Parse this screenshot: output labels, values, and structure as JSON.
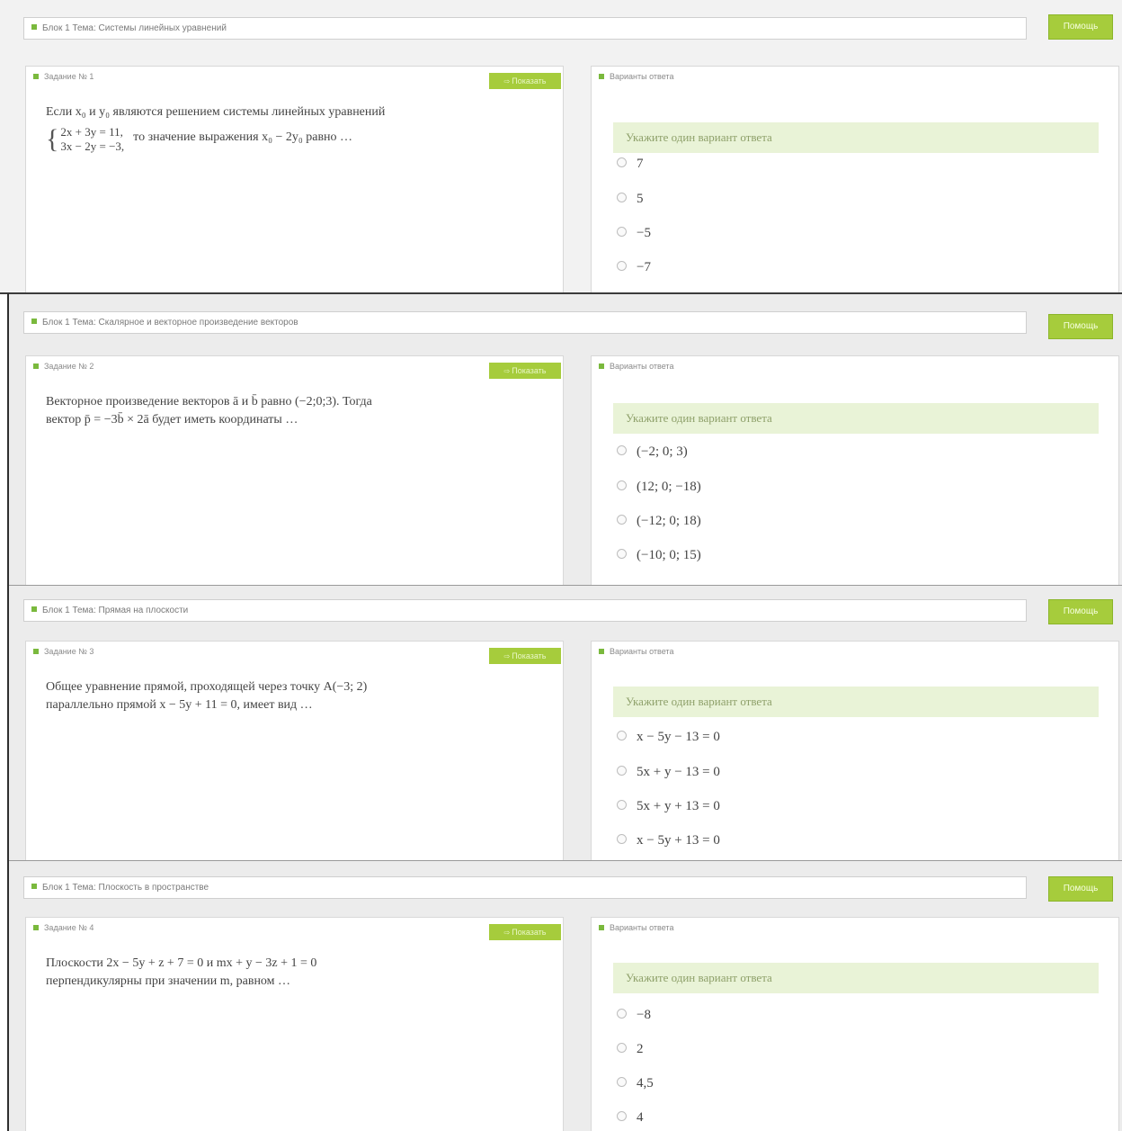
{
  "help_label": "Помощь",
  "show_label": "Показать",
  "panels": [
    {
      "topic": "Блок 1 Тема: Системы линейных уравнений",
      "task_title": "Задание № 1",
      "answers_title": "Варианты ответа",
      "instruction": "Укажите один вариант ответа",
      "question_a": "Если x₀ и y₀ являются решением системы линейных уравнений",
      "system_eq1": "2x + 3y = 11,",
      "system_eq2": "3x − 2y = −3,",
      "question_b": "то значение выражения x₀ − 2y₀ равно …",
      "options": [
        "7",
        "5",
        "−5",
        "−7"
      ]
    },
    {
      "topic": "Блок 1 Тема: Скалярное и векторное произведение векторов",
      "task_title": "Задание № 2",
      "answers_title": "Варианты ответа",
      "instruction": "Укажите один вариант ответа",
      "question_a": "Векторное произведение векторов ā и b̄ равно (−2;0;3). Тогда",
      "question_b": "вектор p̄ = −3b̄ × 2ā будет иметь координаты …",
      "options": [
        "(−2; 0; 3)",
        "(12; 0; −18)",
        "(−12; 0; 18)",
        "(−10; 0; 15)"
      ]
    },
    {
      "topic": "Блок 1 Тема: Прямая на плоскости",
      "task_title": "Задание № 3",
      "answers_title": "Варианты ответа",
      "instruction": "Укажите один вариант ответа",
      "question_a": "Общее уравнение прямой, проходящей через точку A(−3; 2)",
      "question_b": "параллельно прямой x − 5y + 11 = 0, имеет вид …",
      "options": [
        "x − 5y − 13 = 0",
        "5x + y − 13 = 0",
        "5x + y + 13 = 0",
        "x − 5y + 13 = 0"
      ]
    },
    {
      "topic": "Блок 1 Тема: Плоскость в пространстве",
      "task_title": "Задание № 4",
      "answers_title": "Варианты ответа",
      "instruction": "Укажите один вариант ответа",
      "question_a": "Плоскости 2x − 5y + z + 7 = 0 и mx + y − 3z + 1 = 0",
      "question_b": "перпендикулярны при значении m, равном …",
      "options": [
        "−8",
        "2",
        "4,5",
        "4"
      ]
    }
  ],
  "colors": {
    "accent": "#a6cc3c",
    "instruction_bg": "#e9f3d7",
    "marker": "#7ab93d"
  }
}
